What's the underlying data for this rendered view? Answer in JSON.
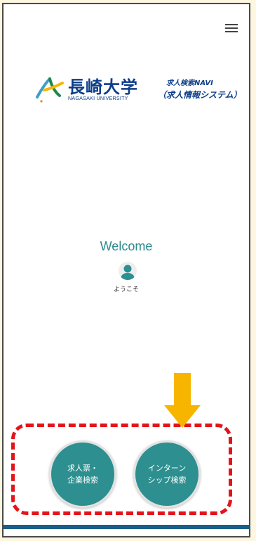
{
  "header": {
    "menu_icon": "hamburger-menu-icon"
  },
  "logo": {
    "name_ja": "長崎大学",
    "name_en": "NAGASAKI UNIVERSITY",
    "system_title": "求人検索NAVI",
    "system_subtitle": "（求人情報システム）",
    "brand_color": "#0d3d8a"
  },
  "welcome": {
    "title": "Welcome",
    "avatar_icon": "user-avatar-icon",
    "subtitle": "ようこそ"
  },
  "buttons": {
    "job_search_label": "求人票・\n企業検索",
    "internship_search_label": "インターン\nシップ検索",
    "color": "#2d8f8f"
  },
  "annotations": {
    "arrow_icon": "down-arrow-icon",
    "arrow_color": "#f7b500",
    "highlight_color": "#e4141b"
  },
  "footer": {
    "bar_color": "#1a5f8a"
  }
}
